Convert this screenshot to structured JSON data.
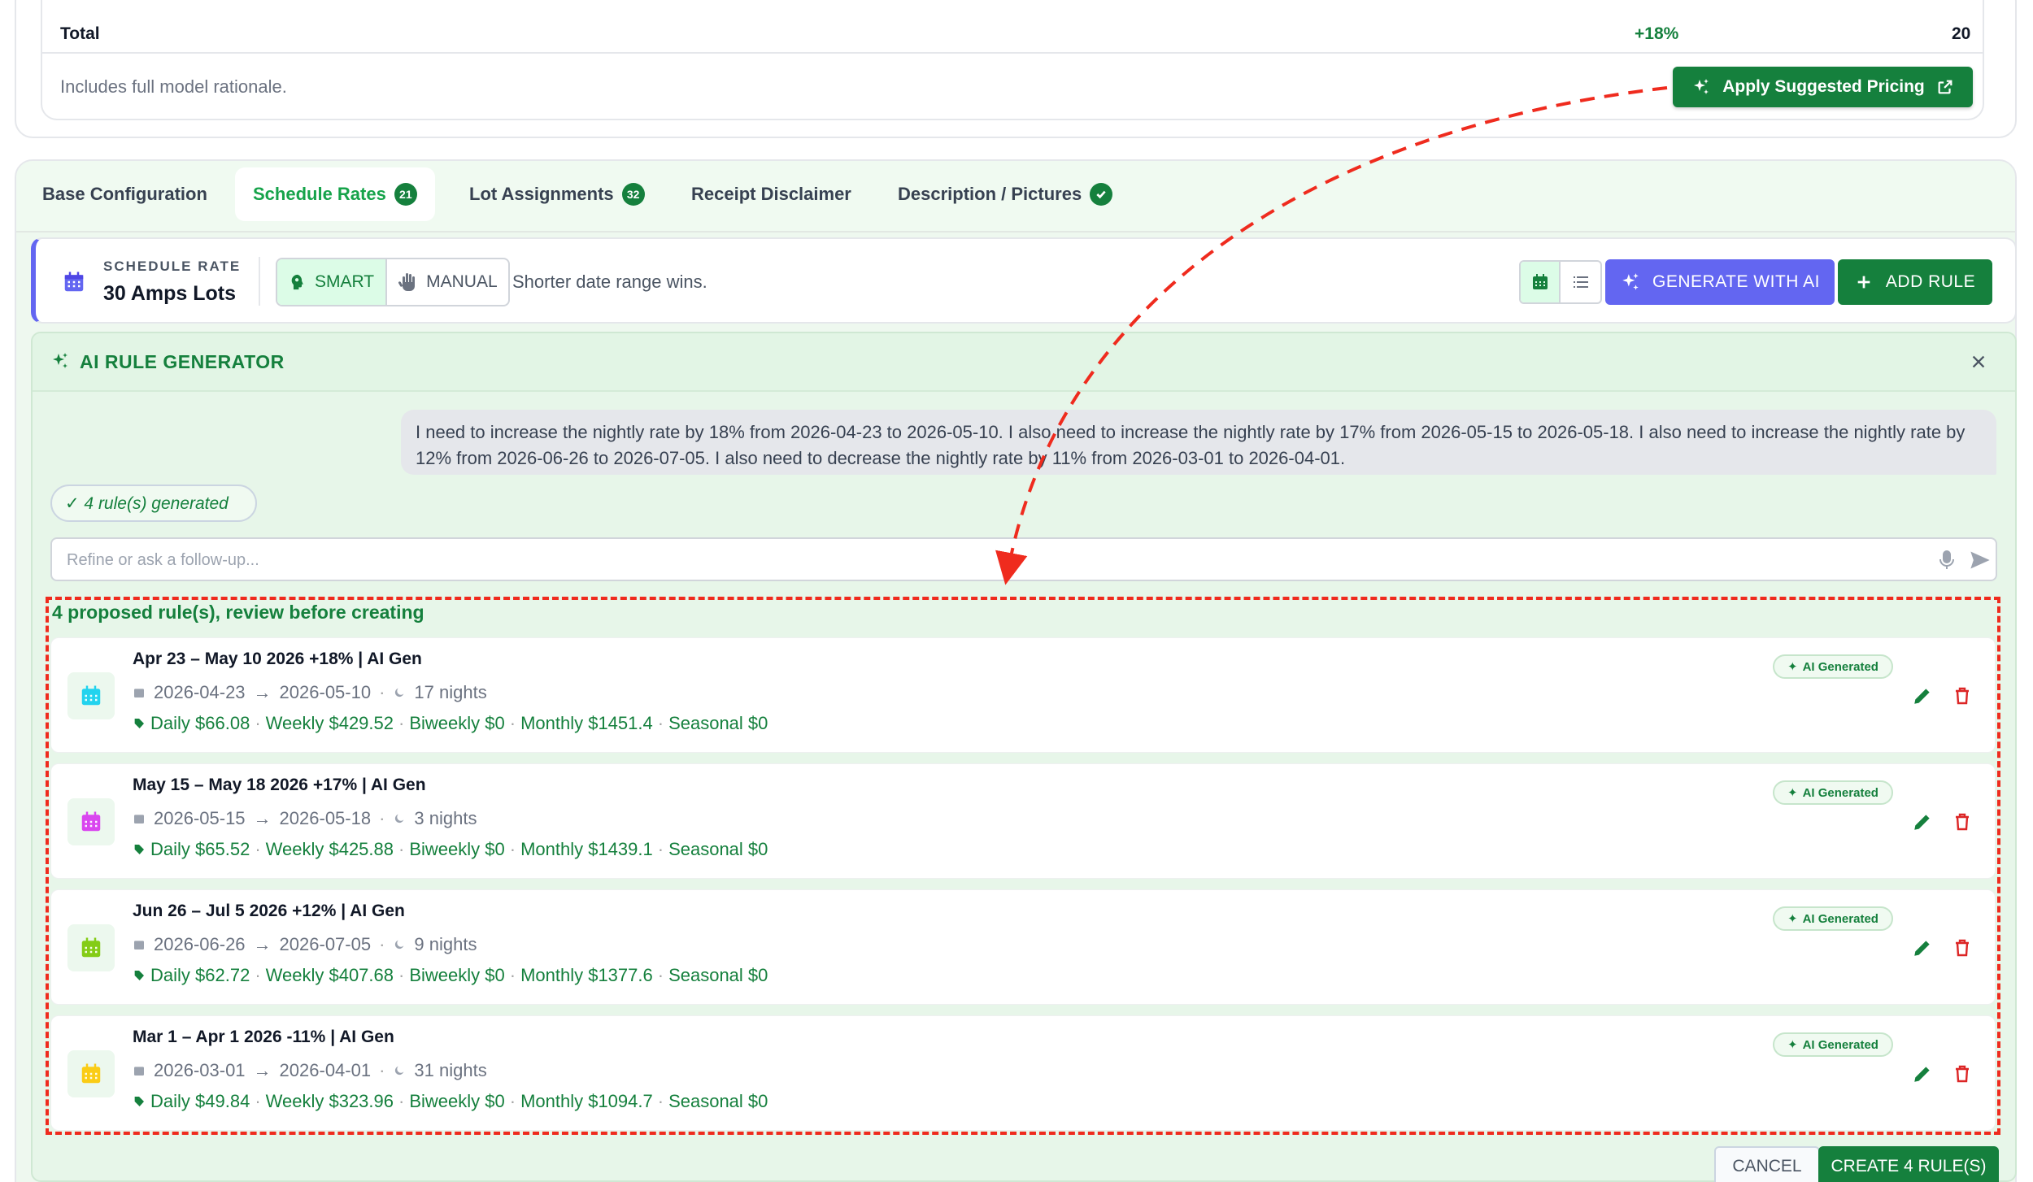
{
  "summary": {
    "total_label": "Total",
    "total_pct": "+18%",
    "total_count": "20",
    "note": "Includes full model rationale.",
    "apply_button": "Apply Suggested Pricing"
  },
  "tabs": [
    {
      "label": "Base Configuration",
      "badge": null
    },
    {
      "label": "Schedule Rates",
      "badge": "21"
    },
    {
      "label": "Lot Assignments",
      "badge": "32"
    },
    {
      "label": "Receipt Disclaimer",
      "badge": null
    },
    {
      "label": "Description / Pictures",
      "badge": "check"
    }
  ],
  "schedule": {
    "caption": "SCHEDULE RATE",
    "title": "30 Amps Lots",
    "mode_smart": "SMART",
    "mode_manual": "MANUAL",
    "hint": "Shorter date range wins.",
    "generate_button": "GENERATE WITH AI",
    "add_rule_button": "ADD RULE"
  },
  "ai_generator": {
    "title": "AI RULE GENERATOR",
    "user_message": "I need to increase the nightly rate by 18% from 2026-04-23 to 2026-05-10. I also need to increase the nightly rate by 17% from 2026-05-15 to 2026-05-18. I also need to increase the nightly rate by 12% from 2026-06-26 to 2026-07-05. I also need to decrease the nightly rate by 11% from 2026-03-01 to 2026-04-01.",
    "generated_chip": "✓ 4 rule(s) generated",
    "followup_placeholder": "Refine or ask a follow-up...",
    "proposed_label": "4 proposed rule(s), review before creating",
    "cancel_button": "CANCEL",
    "create_button": "CREATE 4 RULE(S)"
  },
  "rules": [
    {
      "title": "Apr 23 – May 10 2026 +18% | AI Gen",
      "start": "2026-04-23",
      "end": "2026-05-10",
      "nights": "17 nights",
      "daily": "Daily $66.08",
      "weekly": "Weekly $429.52",
      "biweekly": "Biweekly $0",
      "monthly": "Monthly $1451.4",
      "seasonal": "Seasonal $0",
      "badge": "AI Generated",
      "icon_color": "#22d3ee"
    },
    {
      "title": "May 15 – May 18 2026 +17% | AI Gen",
      "start": "2026-05-15",
      "end": "2026-05-18",
      "nights": "3 nights",
      "daily": "Daily $65.52",
      "weekly": "Weekly $425.88",
      "biweekly": "Biweekly $0",
      "monthly": "Monthly $1439.1",
      "seasonal": "Seasonal $0",
      "badge": "AI Generated",
      "icon_color": "#d946ef"
    },
    {
      "title": "Jun 26 – Jul 5 2026 +12% | AI Gen",
      "start": "2026-06-26",
      "end": "2026-07-05",
      "nights": "9 nights",
      "daily": "Daily $62.72",
      "weekly": "Weekly $407.68",
      "biweekly": "Biweekly $0",
      "monthly": "Monthly $1377.6",
      "seasonal": "Seasonal $0",
      "badge": "AI Generated",
      "icon_color": "#84cc16"
    },
    {
      "title": "Mar 1 – Apr 1 2026 -11% | AI Gen",
      "start": "2026-03-01",
      "end": "2026-04-01",
      "nights": "31 nights",
      "daily": "Daily $49.84",
      "weekly": "Weekly $323.96",
      "biweekly": "Biweekly $0",
      "monthly": "Monthly $1094.7",
      "seasonal": "Seasonal $0",
      "badge": "AI Generated",
      "icon_color": "#facc15"
    }
  ],
  "colors": {
    "brand_green": "#15803d",
    "ai_purple": "#6366f1",
    "annotation_red": "#ef2b1e",
    "panel_bg": "#e7f6e9"
  }
}
